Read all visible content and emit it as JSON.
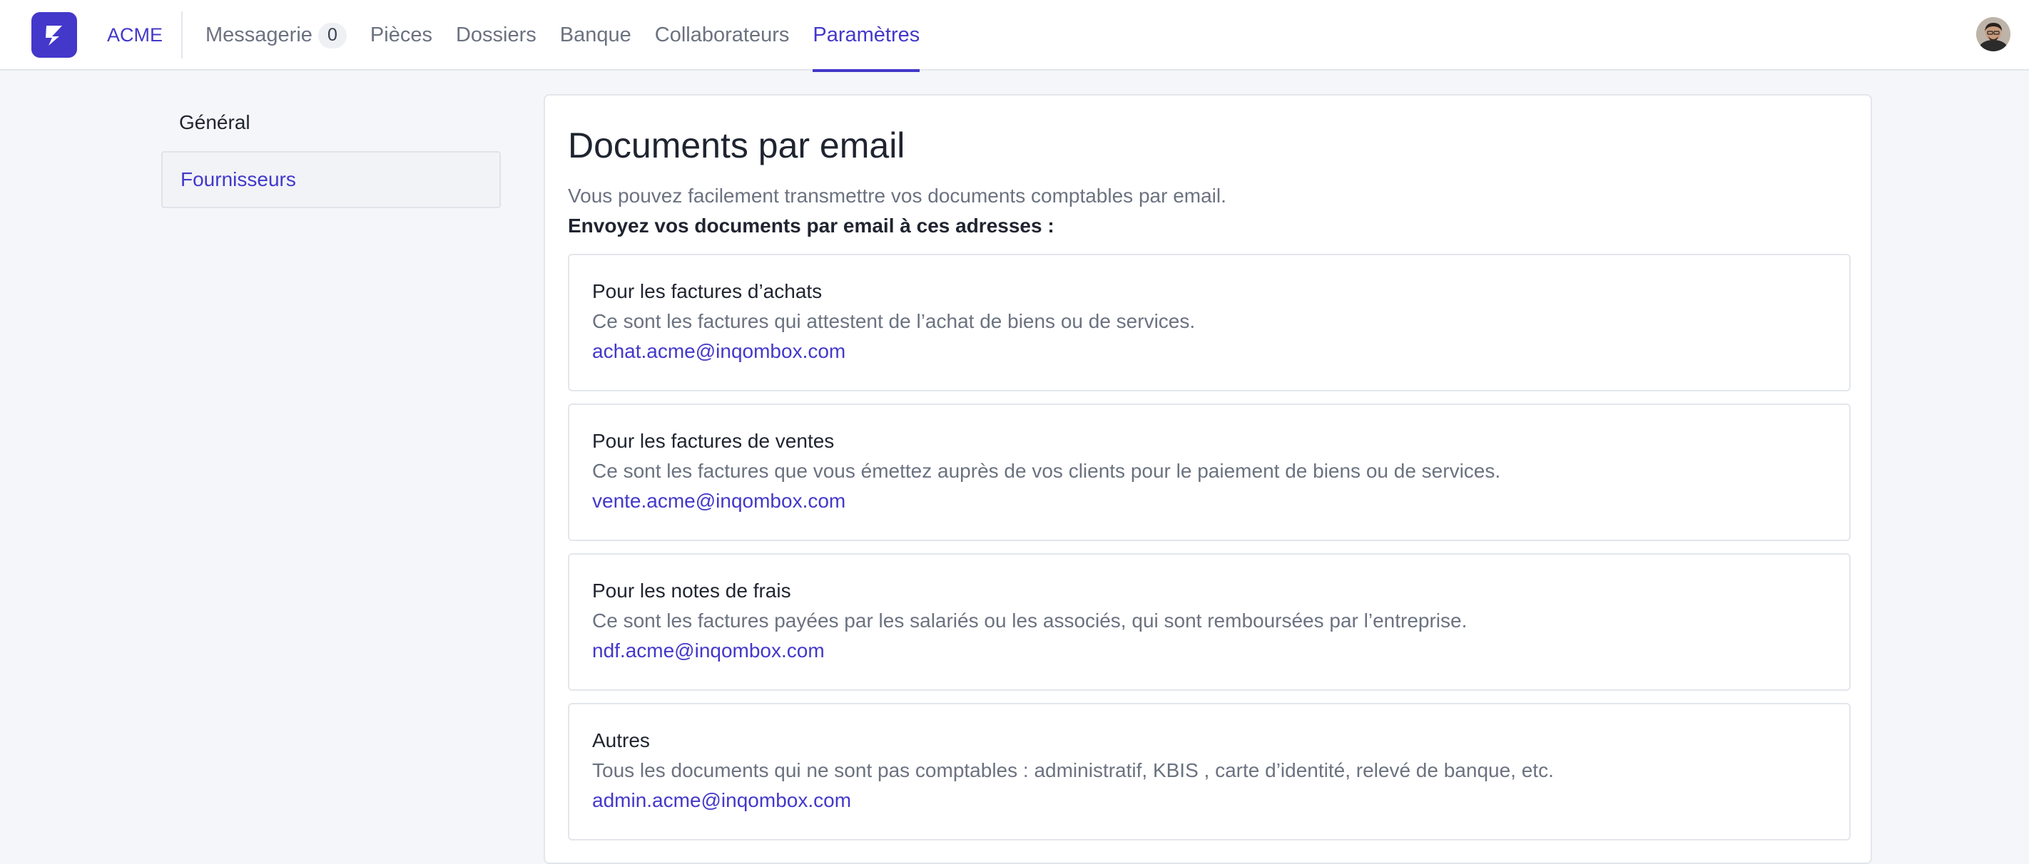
{
  "colors": {
    "accent": "#4338ca",
    "muted_text": "#6b7280",
    "background": "#f4f6f9"
  },
  "header": {
    "logo_icon": "lightning-logo-icon",
    "org_name": "ACME",
    "nav": [
      {
        "label": "Messagerie",
        "badge": "0"
      },
      {
        "label": "Pièces"
      },
      {
        "label": "Dossiers"
      },
      {
        "label": "Banque"
      },
      {
        "label": "Collaborateurs"
      },
      {
        "label": "Paramètres",
        "active": true
      }
    ],
    "avatar_icon": "user-avatar"
  },
  "sidebar": {
    "items": [
      {
        "label": "Général"
      },
      {
        "label": "Fournisseurs",
        "active": true
      }
    ]
  },
  "main": {
    "title": "Documents par email",
    "intro": "Vous pouvez facilement transmettre vos documents comptables par email.",
    "intro_strong": "Envoyez vos documents par email à ces adresses :",
    "cards": [
      {
        "title": "Pour les factures d’achats",
        "description": "Ce sont les factures qui attestent de l’achat de biens ou de services.",
        "email": "achat.acme@inqombox.com"
      },
      {
        "title": "Pour les factures de ventes",
        "description": "Ce sont les factures que vous émettez auprès de vos clients pour le paiement de biens ou de services.",
        "email": "vente.acme@inqombox.com"
      },
      {
        "title": "Pour les notes de frais",
        "description": "Ce sont les factures payées par les salariés ou les associés, qui sont remboursées par l’entreprise.",
        "email": "ndf.acme@inqombox.com"
      },
      {
        "title": "Autres",
        "description": "Tous les documents qui ne sont pas comptables : administratif, KBIS , carte d’identité, relevé de banque, etc.",
        "email": "admin.acme@inqombox.com"
      }
    ]
  }
}
